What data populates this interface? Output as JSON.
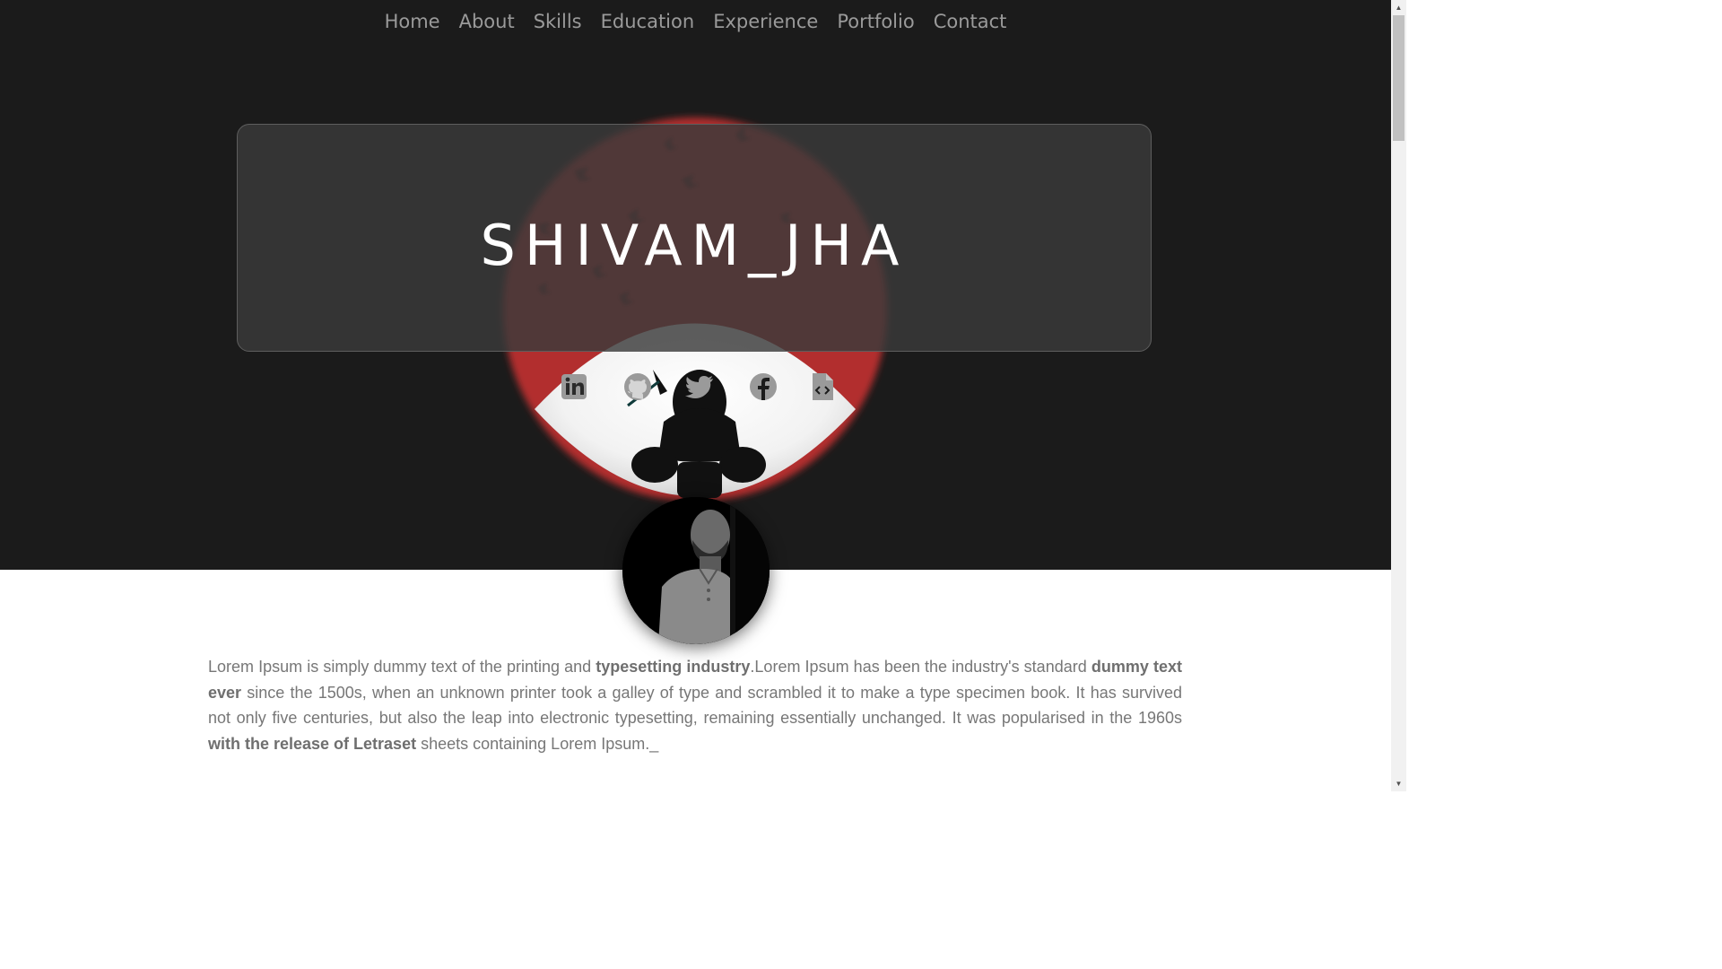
{
  "nav": {
    "items": [
      {
        "label": "Home"
      },
      {
        "label": "About"
      },
      {
        "label": "Skills"
      },
      {
        "label": "Education"
      },
      {
        "label": "Experience"
      },
      {
        "label": "Portfolio"
      },
      {
        "label": "Contact"
      }
    ]
  },
  "hero": {
    "title": "SHIVAM_JHA",
    "accent_color": "#b22d2d",
    "social_icons": [
      "linkedin-icon",
      "github-icon",
      "twitter-icon",
      "facebook-icon",
      "code-file-icon"
    ]
  },
  "about": {
    "p1": "Lorem Ipsum is simply dummy text of the printing and ",
    "b1": "typesetting industry",
    "p2": ".Lorem Ipsum has been the industry's standard ",
    "b2": "dummy text ever",
    "p3": " since the 1500s, when an unknown printer took a galley of type and scrambled it to make a type specimen book. It has survived not only five centuries, but also the leap into electronic typesetting, remaining essentially unchanged. It was popularised in the 1960s ",
    "b3": "with the release of Letraset",
    "p4": " sheets containing Lorem Ipsum.",
    "cursor": "_"
  }
}
